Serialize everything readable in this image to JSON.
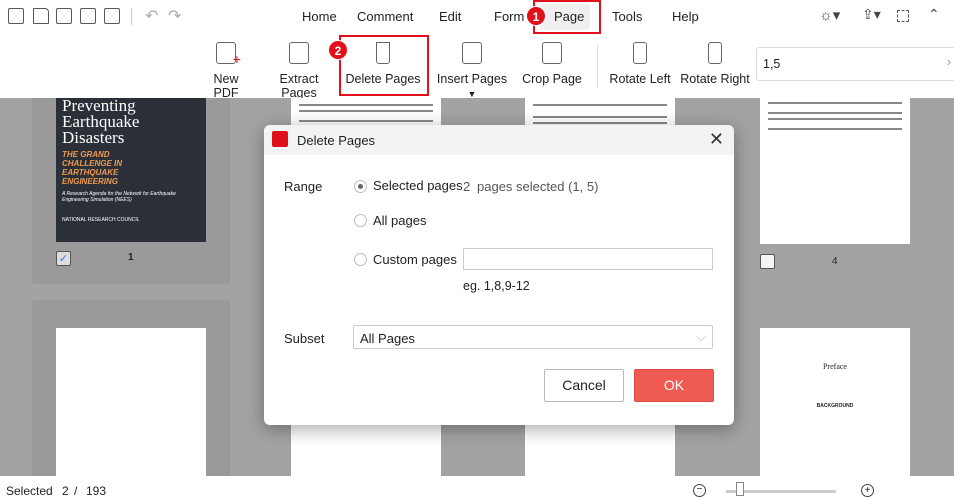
{
  "quick_access": {
    "icons": [
      "new-file-icon",
      "open-folder-icon",
      "save-icon",
      "save-as-icon",
      "print-icon",
      "undo-icon",
      "redo-icon"
    ]
  },
  "menu": {
    "items": [
      "Home",
      "Comment",
      "Edit",
      "Form",
      "Page",
      "Tools",
      "Help"
    ],
    "active": "Page"
  },
  "window_icons": [
    "theme-icon",
    "share-icon",
    "fullscreen-icon",
    "collapse-icon"
  ],
  "ribbon": {
    "new_pdf": "New PDF",
    "extract_pages": "Extract Pages",
    "delete_pages": "Delete Pages",
    "insert_pages": "Insert Pages",
    "crop_page": "Crop Page",
    "rotate_left": "Rotate Left",
    "rotate_right": "Rotate Right",
    "page_range_value": "1,5"
  },
  "annotations": {
    "step1": "1",
    "step2": "2"
  },
  "thumbnails": {
    "page1_label": "1",
    "page4_label": "4",
    "cover_title": "Preventing Earthquake Disasters",
    "cover_subtitle": "THE GRAND CHALLENGE IN EARTHQUAKE ENGINEERING",
    "cover_caption": "A Research Agenda for the Network for Earthquake Engineering Simulation (NEES)",
    "cover_publisher": "NATIONAL RESEARCH COUNCIL",
    "preface": "Preface",
    "background": "BACKGROUND"
  },
  "dialog": {
    "title": "Delete Pages",
    "range_label": "Range",
    "selected_pages": "Selected pages",
    "selected_count": "2",
    "selected_info": "pages selected (1, 5)",
    "all_pages": "All pages",
    "custom_pages": "Custom pages",
    "custom_value": "",
    "custom_hint": "eg. 1,8,9-12",
    "subset_label": "Subset",
    "subset_value": "All Pages",
    "cancel": "Cancel",
    "ok": "OK",
    "ok_color": "#ef5a52"
  },
  "status": {
    "selected_label": "Selected",
    "selected": "2",
    "separator": "/",
    "total": "193"
  },
  "colors": {
    "accent": "#e0111b"
  }
}
